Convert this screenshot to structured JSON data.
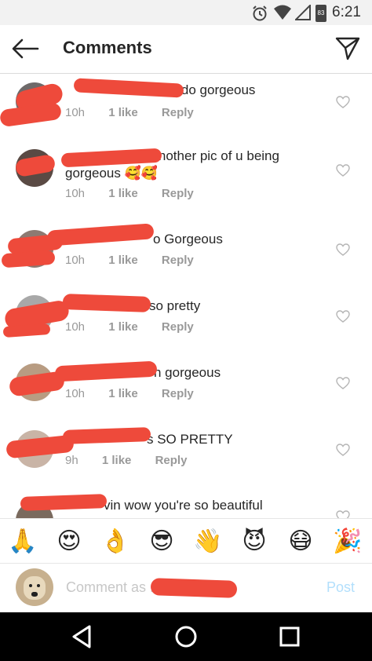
{
  "status_bar": {
    "time": "6:21",
    "battery": "83"
  },
  "header": {
    "title": "Comments"
  },
  "comments": [
    {
      "text": "ando gorgeous",
      "time": "10h",
      "likes": "1 like",
      "reply": "Reply"
    },
    {
      "text": "f another pic of u being gorgeous 🥰🥰",
      "time": "10h",
      "likes": "1 like",
      "reply": "Reply"
    },
    {
      "text": "o Gorgeous",
      "time": "10h",
      "likes": "1 like",
      "reply": "Reply"
    },
    {
      "text": "so pretty",
      "time": "10h",
      "likes": "1 like",
      "reply": "Reply"
    },
    {
      "text": "h gorgeous",
      "time": "10h",
      "likes": "1 like",
      "reply": "Reply"
    },
    {
      "text": "s SO PRETTY",
      "time": "9h",
      "likes": "1 like",
      "reply": "Reply"
    },
    {
      "text": "vin wow you're so beautiful",
      "time": "",
      "likes": "",
      "reply": ""
    }
  ],
  "emoji_bar": [
    "🙏",
    "😍",
    "👌",
    "😎",
    "👋",
    "😈",
    "😷",
    "🎉"
  ],
  "composer": {
    "placeholder": "Comment as ...",
    "post_label": "Post"
  },
  "colors": {
    "redaction": "#ee4a3b",
    "post_disabled": "#b2dffc",
    "meta": "#999999"
  }
}
